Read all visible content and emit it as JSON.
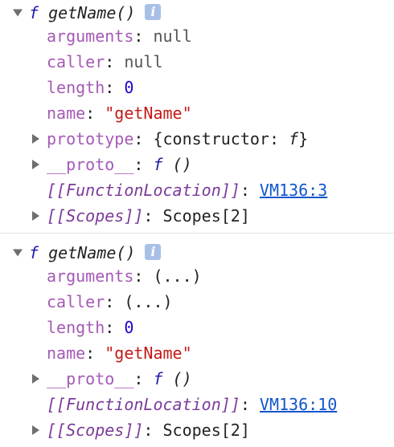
{
  "functions": [
    {
      "header": {
        "f": "f",
        "name": "getName()",
        "info": "i"
      },
      "props": {
        "arguments": {
          "key": "arguments",
          "value": "null"
        },
        "caller": {
          "key": "caller",
          "value": "null"
        },
        "length": {
          "key": "length",
          "value": "0"
        },
        "name": {
          "key": "name",
          "value": "\"getName\""
        },
        "prototype": {
          "key": "prototype",
          "value_prefix": "{constructor: ",
          "value_f": "f",
          "value_suffix": "}"
        },
        "proto": {
          "key": "__proto__",
          "value_f": "f",
          "value_suffix": " ()"
        },
        "location": {
          "key": "[[FunctionLocation]]",
          "value": "VM136:3"
        },
        "scopes": {
          "key": "[[Scopes]]",
          "value": "Scopes[2]"
        }
      }
    },
    {
      "header": {
        "f": "f",
        "name": "getName()",
        "info": "i"
      },
      "props": {
        "arguments": {
          "key": "arguments",
          "value": "(...)"
        },
        "caller": {
          "key": "caller",
          "value": "(...)"
        },
        "length": {
          "key": "length",
          "value": "0"
        },
        "name": {
          "key": "name",
          "value": "\"getName\""
        },
        "proto": {
          "key": "__proto__",
          "value_f": "f",
          "value_suffix": " ()"
        },
        "location": {
          "key": "[[FunctionLocation]]",
          "value": "VM136:10"
        },
        "scopes": {
          "key": "[[Scopes]]",
          "value": "Scopes[2]"
        }
      }
    }
  ]
}
